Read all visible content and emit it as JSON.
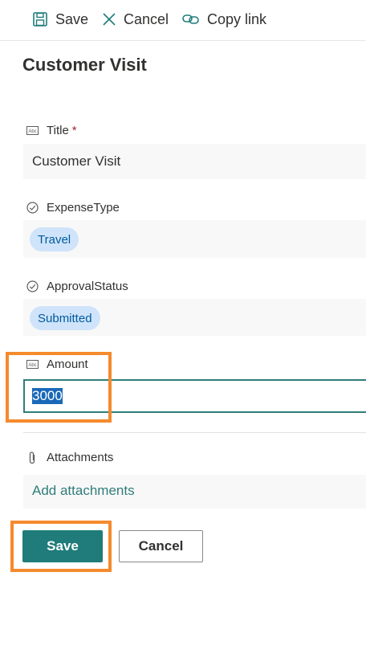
{
  "toolbar": {
    "save_label": "Save",
    "cancel_label": "Cancel",
    "copy_link_label": "Copy link"
  },
  "form": {
    "title": "Customer Visit",
    "fields": {
      "title": {
        "label": "Title",
        "required_marker": "*",
        "value": "Customer Visit"
      },
      "expense_type": {
        "label": "ExpenseType",
        "value": "Travel"
      },
      "approval_status": {
        "label": "ApprovalStatus",
        "value": "Submitted"
      },
      "amount": {
        "label": "Amount",
        "value": "3000"
      },
      "attachments": {
        "label": "Attachments",
        "link_text": "Add attachments"
      }
    }
  },
  "actions": {
    "save_label": "Save",
    "cancel_label": "Cancel"
  },
  "icons": {
    "toolbar_save": "save-icon",
    "toolbar_cancel": "close-icon",
    "toolbar_copy": "link-icon",
    "text_field": "text-field-icon",
    "choice_field": "choice-check-icon",
    "attachment": "paperclip-icon"
  },
  "colors": {
    "accent": "#1f7c7a",
    "pill_bg": "#cfe4fa",
    "pill_text": "#005a9e",
    "highlight": "#f58a2d",
    "required": "#a4262c"
  }
}
